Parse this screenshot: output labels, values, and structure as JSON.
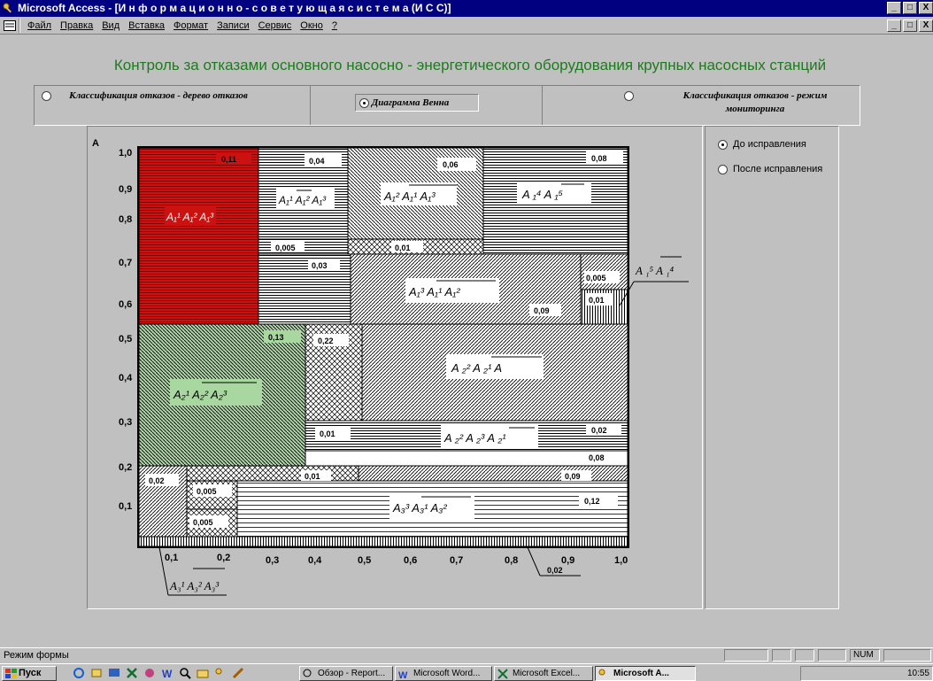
{
  "window": {
    "title": "Microsoft Access - [И н ф о р м а ц и о н н о - с о в е т у ю щ а я   с и с т е м а  (И С С)]",
    "buttons": [
      "_",
      "□",
      "X"
    ]
  },
  "menu": [
    "Файл",
    "Правка",
    "Вид",
    "Вставка",
    "Формат",
    "Записи",
    "Сервис",
    "Окно",
    "?"
  ],
  "form": {
    "heading": "Контроль за отказами основного насосно - энергетического оборудования крупных насосных станций",
    "options": [
      {
        "label": "Классификация отказов - дерево отказов",
        "selected": false
      },
      {
        "label": "Диаграмма Венна",
        "selected": true
      },
      {
        "label": "Классификация отказов - режим мониторинга",
        "selected": false
      }
    ],
    "side_options": [
      {
        "label": "До исправления",
        "selected": true
      },
      {
        "label": "После исправления",
        "selected": false
      }
    ]
  },
  "chart": {
    "axis_title": "A",
    "y_ticks": [
      "1,0",
      "0,9",
      "0,8",
      "0,7",
      "0,6",
      "0,5",
      "0,4",
      "0,3",
      "0,2",
      "0,1"
    ],
    "x_ticks": [
      "0,1",
      "0,2",
      "0,3",
      "0,4",
      "0,5",
      "0,6",
      "0,7",
      "0,8",
      "0,9",
      "1,0"
    ],
    "value_labels": {
      "v011": "0,11",
      "v004": "0,04",
      "v006": "0,06",
      "v008a": "0,08",
      "v0005a": "0,005",
      "v001a": "0,01",
      "v003": "0,03",
      "v0005b": "0,005",
      "v001b": "0,01",
      "v009a": "0,09",
      "v013": "0,13",
      "v022": "0,22",
      "v001c": "0,01",
      "v002a": "0,02",
      "v008b": "0,08",
      "v001d": "0,01",
      "v009b": "0,09",
      "v002b": "0,02",
      "v0005c": "0,005",
      "v0005d": "0,005",
      "v012": "0,12",
      "v002c": "0,02"
    },
    "colors": {
      "red": "#cc1111",
      "green": "#a8d8a0"
    }
  },
  "status": {
    "text": "Режим формы",
    "num": "NUM"
  },
  "taskbar": {
    "start": "Пуск",
    "buttons": [
      {
        "label": "Обзор - Report...",
        "active": false
      },
      {
        "label": "Microsoft Word...",
        "active": false
      },
      {
        "label": "Microsoft Excel...",
        "active": false
      },
      {
        "label": "Microsoft A...",
        "active": true
      }
    ],
    "clock": "10:55"
  }
}
